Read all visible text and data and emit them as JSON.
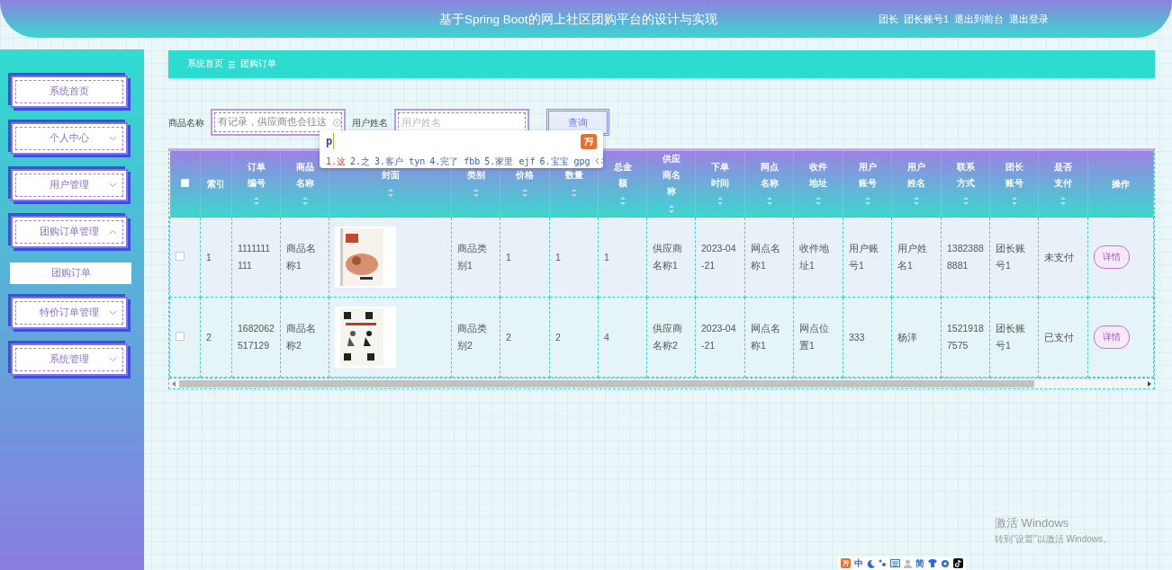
{
  "header": {
    "title": "基于Spring Boot的网上社区团购平台的设计与实现",
    "user": [
      "团长",
      "团长账号1"
    ],
    "links": [
      "退出到前台",
      "退出登录"
    ]
  },
  "sidebar": {
    "items": [
      {
        "label": "系统首页",
        "kind": "link"
      },
      {
        "label": "个人中心",
        "kind": "menu",
        "expanded": false
      },
      {
        "label": "用户管理",
        "kind": "menu",
        "expanded": false
      },
      {
        "label": "团购订单管理",
        "kind": "menu",
        "expanded": true,
        "children": [
          {
            "label": "团购订单",
            "selected": true
          }
        ]
      },
      {
        "label": "特价订单管理",
        "kind": "menu",
        "expanded": false
      },
      {
        "label": "系统管理",
        "kind": "menu",
        "expanded": false
      }
    ]
  },
  "breadcrumb": [
    "系统首页",
    "团购订单"
  ],
  "search": {
    "fields": [
      {
        "label": "商品名称",
        "value": "有记录，供应商也会往这"
      },
      {
        "label": "用户姓名",
        "placeholder": "用户姓名"
      }
    ],
    "button": "查询"
  },
  "ime": {
    "input": "p",
    "candidates": [
      {
        "index": "1.",
        "word": "这",
        "selected": true
      },
      {
        "index": "2.",
        "word": "之",
        "selected": false
      },
      {
        "index": "3.",
        "word": "客户",
        "hint": "tyn",
        "selected": false
      },
      {
        "index": "4.",
        "word": "完了",
        "hint": "fbb",
        "selected": false
      },
      {
        "index": "5.",
        "word": "家里",
        "hint": "ejf",
        "selected": false
      },
      {
        "index": "6.",
        "word": "宝宝",
        "hint": "gpg",
        "selected": false
      }
    ]
  },
  "table": {
    "select_all": {
      "checked": false
    },
    "columns": [
      {
        "label": "索引",
        "sortable": false
      },
      {
        "label": "订单编号",
        "sortable": true
      },
      {
        "label": "商品名称",
        "sortable": true
      },
      {
        "label": "封面",
        "sortable": true
      },
      {
        "label": "类别",
        "sortable": true
      },
      {
        "label": "价格",
        "sortable": true
      },
      {
        "label": "数量",
        "sortable": true
      },
      {
        "label": "总金额",
        "sortable": true
      },
      {
        "label": "供应商名称",
        "sortable": true
      },
      {
        "label": "下单时间",
        "sortable": true
      },
      {
        "label": "网点名称",
        "sortable": true
      },
      {
        "label": "收件地址",
        "sortable": true
      },
      {
        "label": "用户账号",
        "sortable": true
      },
      {
        "label": "用户姓名",
        "sortable": true
      },
      {
        "label": "联系方式",
        "sortable": true
      },
      {
        "label": "团长账号",
        "sortable": true
      },
      {
        "label": "是否支付",
        "sortable": true
      },
      {
        "label": "操作",
        "sortable": false
      }
    ],
    "rows": [
      {
        "checked": false,
        "cells": [
          "1",
          "1111111111",
          "商品名称1",
          {
            "kind": "picture"
          },
          "商品类别1",
          "1",
          "1",
          "1",
          "供应商名称1",
          "2023-04-21",
          "网点名称1",
          "收件地址1",
          "用户账号1",
          "用户姓名1",
          "13823888881",
          "团长账号1",
          "未支付",
          {
            "kind": "button",
            "label": "详情"
          }
        ]
      },
      {
        "checked": false,
        "cells": [
          "2",
          "1682062517129",
          "商品名称2",
          {
            "kind": "picture"
          },
          "商品类别2",
          "2",
          "2",
          "4",
          "供应商名称2",
          "2023-04-21",
          "网点名称1",
          "网点位置1",
          "333",
          "杨洋",
          "15219187575",
          "团长账号1",
          "已支付",
          {
            "kind": "button",
            "label": "详情"
          }
        ]
      }
    ]
  },
  "ime_toolbar": [
    "中",
    "简"
  ],
  "activation": {
    "title": "激活 Windows",
    "subtitle": "转到“设置”以激活 Windows。"
  }
}
